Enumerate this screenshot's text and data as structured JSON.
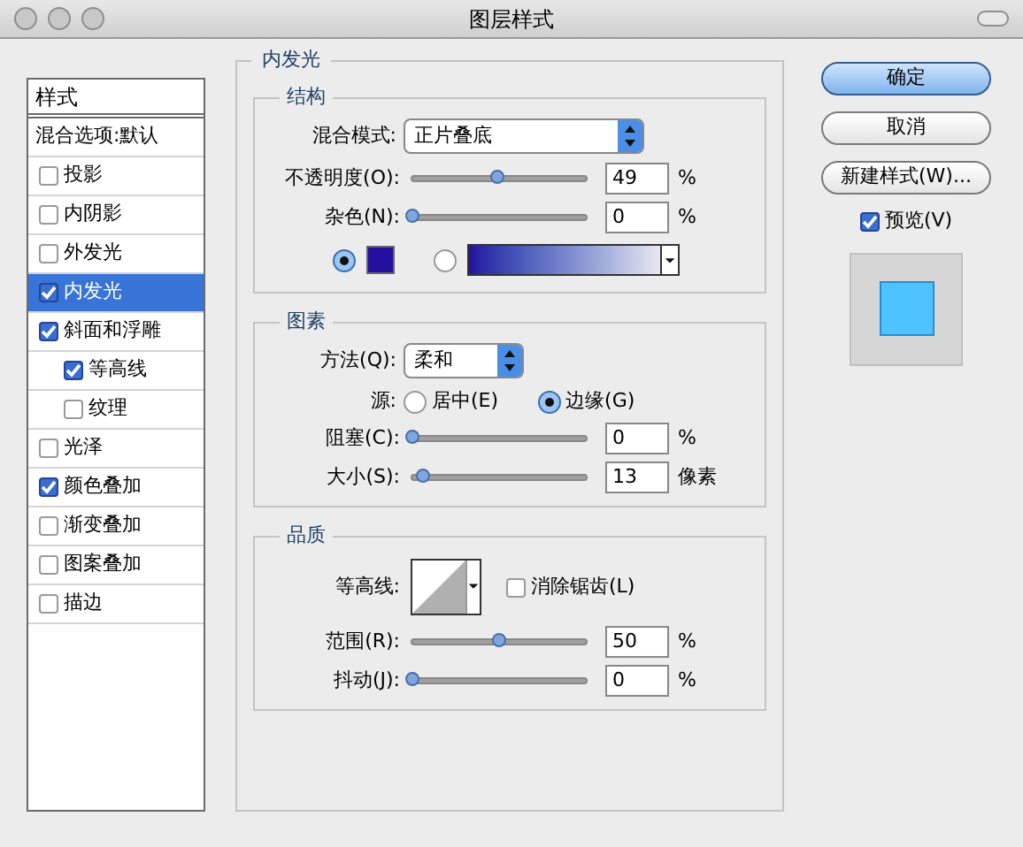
{
  "window": {
    "title": "图层样式"
  },
  "sidebar": {
    "header": "样式",
    "blend_options": {
      "label": "混合选项:默认",
      "selected": false
    },
    "items": [
      {
        "label": "投影",
        "checked": false,
        "selected": false
      },
      {
        "label": "内阴影",
        "checked": false,
        "selected": false
      },
      {
        "label": "外发光",
        "checked": false,
        "selected": false
      },
      {
        "label": "内发光",
        "checked": true,
        "selected": true
      },
      {
        "label": "斜面和浮雕",
        "checked": true,
        "selected": false,
        "children": [
          {
            "label": "等高线",
            "checked": true,
            "selected": false
          },
          {
            "label": "纹理",
            "checked": false,
            "selected": false
          }
        ]
      },
      {
        "label": "光泽",
        "checked": false,
        "selected": false
      },
      {
        "label": "颜色叠加",
        "checked": true,
        "selected": false
      },
      {
        "label": "渐变叠加",
        "checked": false,
        "selected": false
      },
      {
        "label": "图案叠加",
        "checked": false,
        "selected": false
      },
      {
        "label": "描边",
        "checked": false,
        "selected": false
      }
    ]
  },
  "panel": {
    "title": "内发光",
    "structure": {
      "title": "结构",
      "blend_mode": {
        "label": "混合模式:",
        "value": "正片叠底"
      },
      "sliders": [
        {
          "label": "不透明度(O):",
          "level": 0.49,
          "value": "49",
          "unit": "%"
        },
        {
          "label": "杂色(N):",
          "level": 0,
          "value": "0",
          "unit": "%"
        }
      ],
      "fill": {
        "color_selected": true,
        "gradient_selected": false
      }
    },
    "elements": {
      "title": "图素",
      "technique": {
        "label": "方法(Q):",
        "value": "柔和"
      },
      "source": {
        "label": "源:",
        "options": [
          {
            "label": "居中(E)",
            "selected": false
          },
          {
            "label": "边缘(G)",
            "selected": true
          }
        ]
      },
      "sliders": [
        {
          "label": "阻塞(C):",
          "level": 0,
          "value": "0",
          "unit": "%"
        },
        {
          "label": "大小(S):",
          "level": 0.06,
          "value": "13",
          "unit": "像素"
        }
      ]
    },
    "quality": {
      "title": "品质",
      "contour": {
        "label": "等高线:"
      },
      "anti_alias": {
        "label": "消除锯齿(L)",
        "checked": false
      },
      "sliders": [
        {
          "label": "范围(R):",
          "level": 0.5,
          "value": "50",
          "unit": "%"
        },
        {
          "label": "抖动(J):",
          "level": 0,
          "value": "0",
          "unit": "%"
        }
      ]
    }
  },
  "buttons": [
    {
      "label": "确定",
      "default": true
    },
    {
      "label": "取消",
      "default": false
    },
    {
      "label": "新建样式(W)...",
      "default": false
    }
  ],
  "preview": {
    "label": "预览(V)",
    "checked": true
  }
}
